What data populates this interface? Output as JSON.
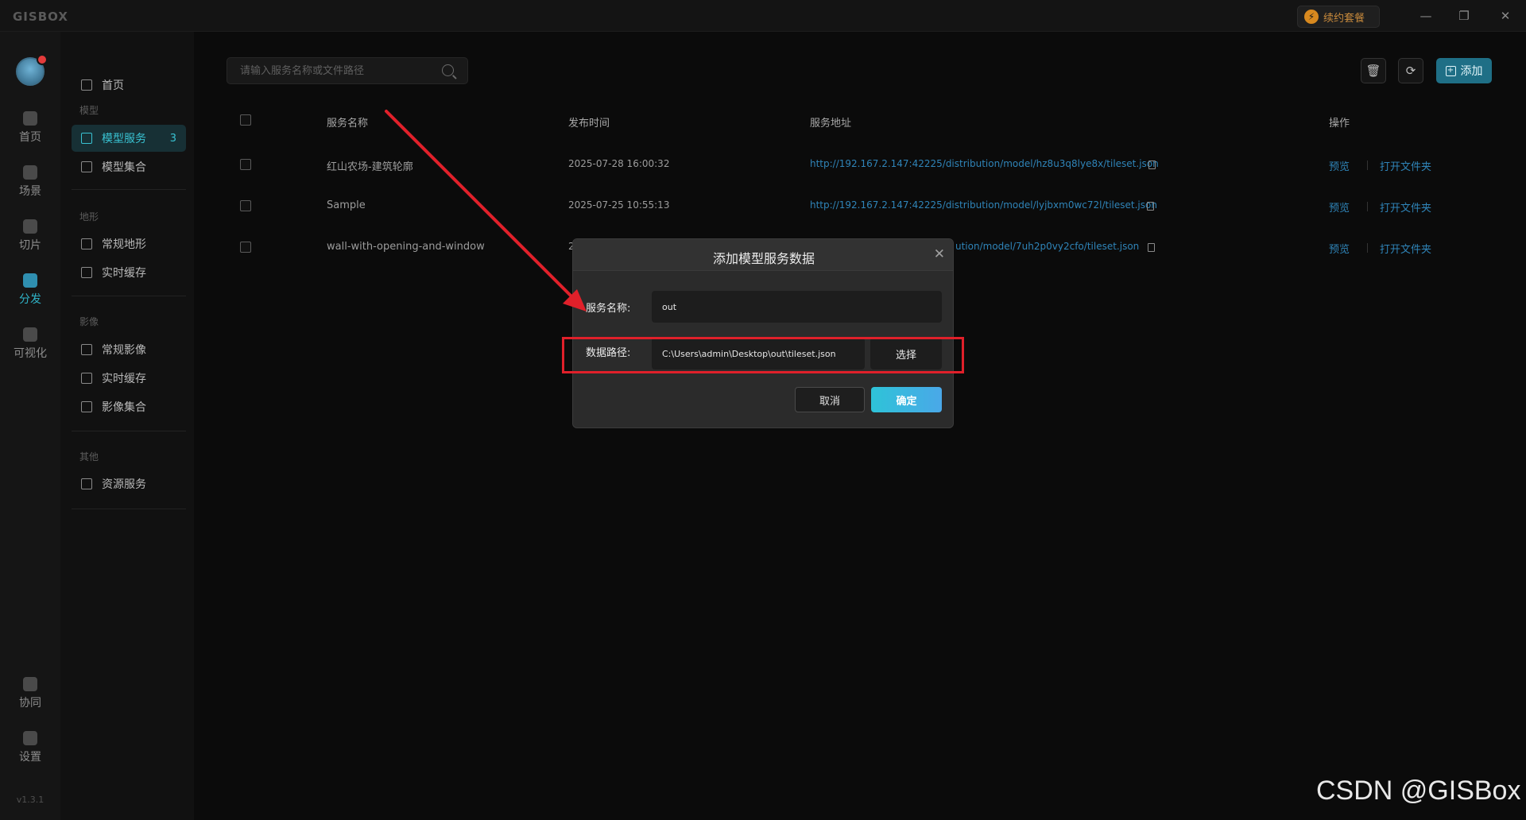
{
  "app": {
    "logo": "GISBOX",
    "renew_label": "续约套餐",
    "version": "v1.3.1"
  },
  "rail": [
    {
      "label": "首页",
      "icon": "home-icon"
    },
    {
      "label": "场景",
      "icon": "cube-icon"
    },
    {
      "label": "切片",
      "icon": "slice-icon"
    },
    {
      "label": "分发",
      "icon": "distribute-icon",
      "active": true
    },
    {
      "label": "可视化",
      "icon": "chart-icon"
    },
    {
      "label": "协同",
      "icon": "lock-icon"
    },
    {
      "label": "设置",
      "icon": "gear-icon"
    }
  ],
  "subnav": {
    "home": "首页",
    "groups": {
      "model": "模型",
      "terrain": "地形",
      "imagery": "影像",
      "other": "其他"
    },
    "items": {
      "model_service": "模型服务",
      "model_service_count": "3",
      "model_set": "模型集合",
      "terrain_normal": "常规地形",
      "terrain_cache": "实时缓存",
      "imagery_normal": "常规影像",
      "imagery_cache": "实时缓存",
      "imagery_set": "影像集合",
      "resource_service": "资源服务"
    }
  },
  "toolbar": {
    "search_placeholder": "请输入服务名称或文件路径",
    "add_label": "添加"
  },
  "table": {
    "headers": {
      "name": "服务名称",
      "time": "发布时间",
      "url": "服务地址",
      "ops": "操作"
    },
    "rows": [
      {
        "name": "红山农场-建筑轮廓",
        "time": "2025-07-28 16:00:32",
        "url": "http://192.167.2.147:42225/distribution/model/hz8u3q8lye8x/tileset.json",
        "preview": "预览",
        "open": "打开文件夹"
      },
      {
        "name": "Sample",
        "time": "2025-07-25 10:55:13",
        "url": "http://192.167.2.147:42225/distribution/model/lyjbxm0wc72l/tileset.json",
        "preview": "预览",
        "open": "打开文件夹"
      },
      {
        "name": "wall-with-opening-and-window",
        "time": "2",
        "url": "ution/model/7uh2p0vy2cfo/tileset.json",
        "preview": "预览",
        "open": "打开文件夹"
      }
    ]
  },
  "modal": {
    "title": "添加模型服务数据",
    "name_label": "服务名称:",
    "name_value": "out",
    "path_label": "数据路径:",
    "path_value": "C:\\Users\\admin\\Desktop\\out\\tileset.json",
    "select_label": "选择",
    "cancel_label": "取消",
    "ok_label": "确定"
  },
  "watermark": "CSDN @GISBox",
  "colors": {
    "accent": "#39c2d2",
    "link": "#2f84b8",
    "annotation": "#e0202a"
  }
}
